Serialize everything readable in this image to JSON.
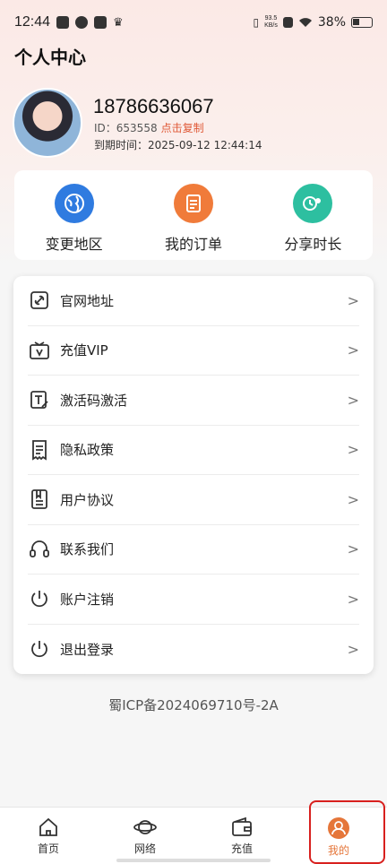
{
  "status_bar": {
    "time": "12:44",
    "speed_top": "93.5",
    "speed_unit": "KB/s",
    "battery": "38%"
  },
  "header": {
    "title": "个人中心"
  },
  "profile": {
    "phone": "18786636067",
    "id_label": "ID：",
    "id_value": "653558",
    "copy_label": "点击复制",
    "expire_label": "到期时间：",
    "expire_value": "2025-09-12 12:44:14"
  },
  "quick_actions": [
    {
      "label": "变更地区",
      "icon": "globe-icon",
      "color": "#2f7be0"
    },
    {
      "label": "我的订单",
      "icon": "orders-icon",
      "color": "#f07b3a"
    },
    {
      "label": "分享时长",
      "icon": "share-icon",
      "color": "#2dbfa0"
    }
  ],
  "menu": [
    {
      "label": "官网地址",
      "icon": "link-icon"
    },
    {
      "label": "充值VIP",
      "icon": "vip-icon"
    },
    {
      "label": "激活码激活",
      "icon": "activation-code-icon"
    },
    {
      "label": "隐私政策",
      "icon": "privacy-icon"
    },
    {
      "label": "用户协议",
      "icon": "agreement-icon"
    },
    {
      "label": "联系我们",
      "icon": "headset-icon"
    },
    {
      "label": "账户注销",
      "icon": "power-icon"
    },
    {
      "label": "退出登录",
      "icon": "power-icon"
    }
  ],
  "icp": "蜀ICP备2024069710号-2A",
  "tabs": [
    {
      "label": "首页",
      "icon": "home-icon"
    },
    {
      "label": "网络",
      "icon": "planet-icon"
    },
    {
      "label": "充值",
      "icon": "wallet-icon"
    },
    {
      "label": "我的",
      "icon": "user-icon",
      "active": true
    }
  ],
  "colors": {
    "accent": "#e5763a",
    "highlight_box": "#d8201e"
  }
}
